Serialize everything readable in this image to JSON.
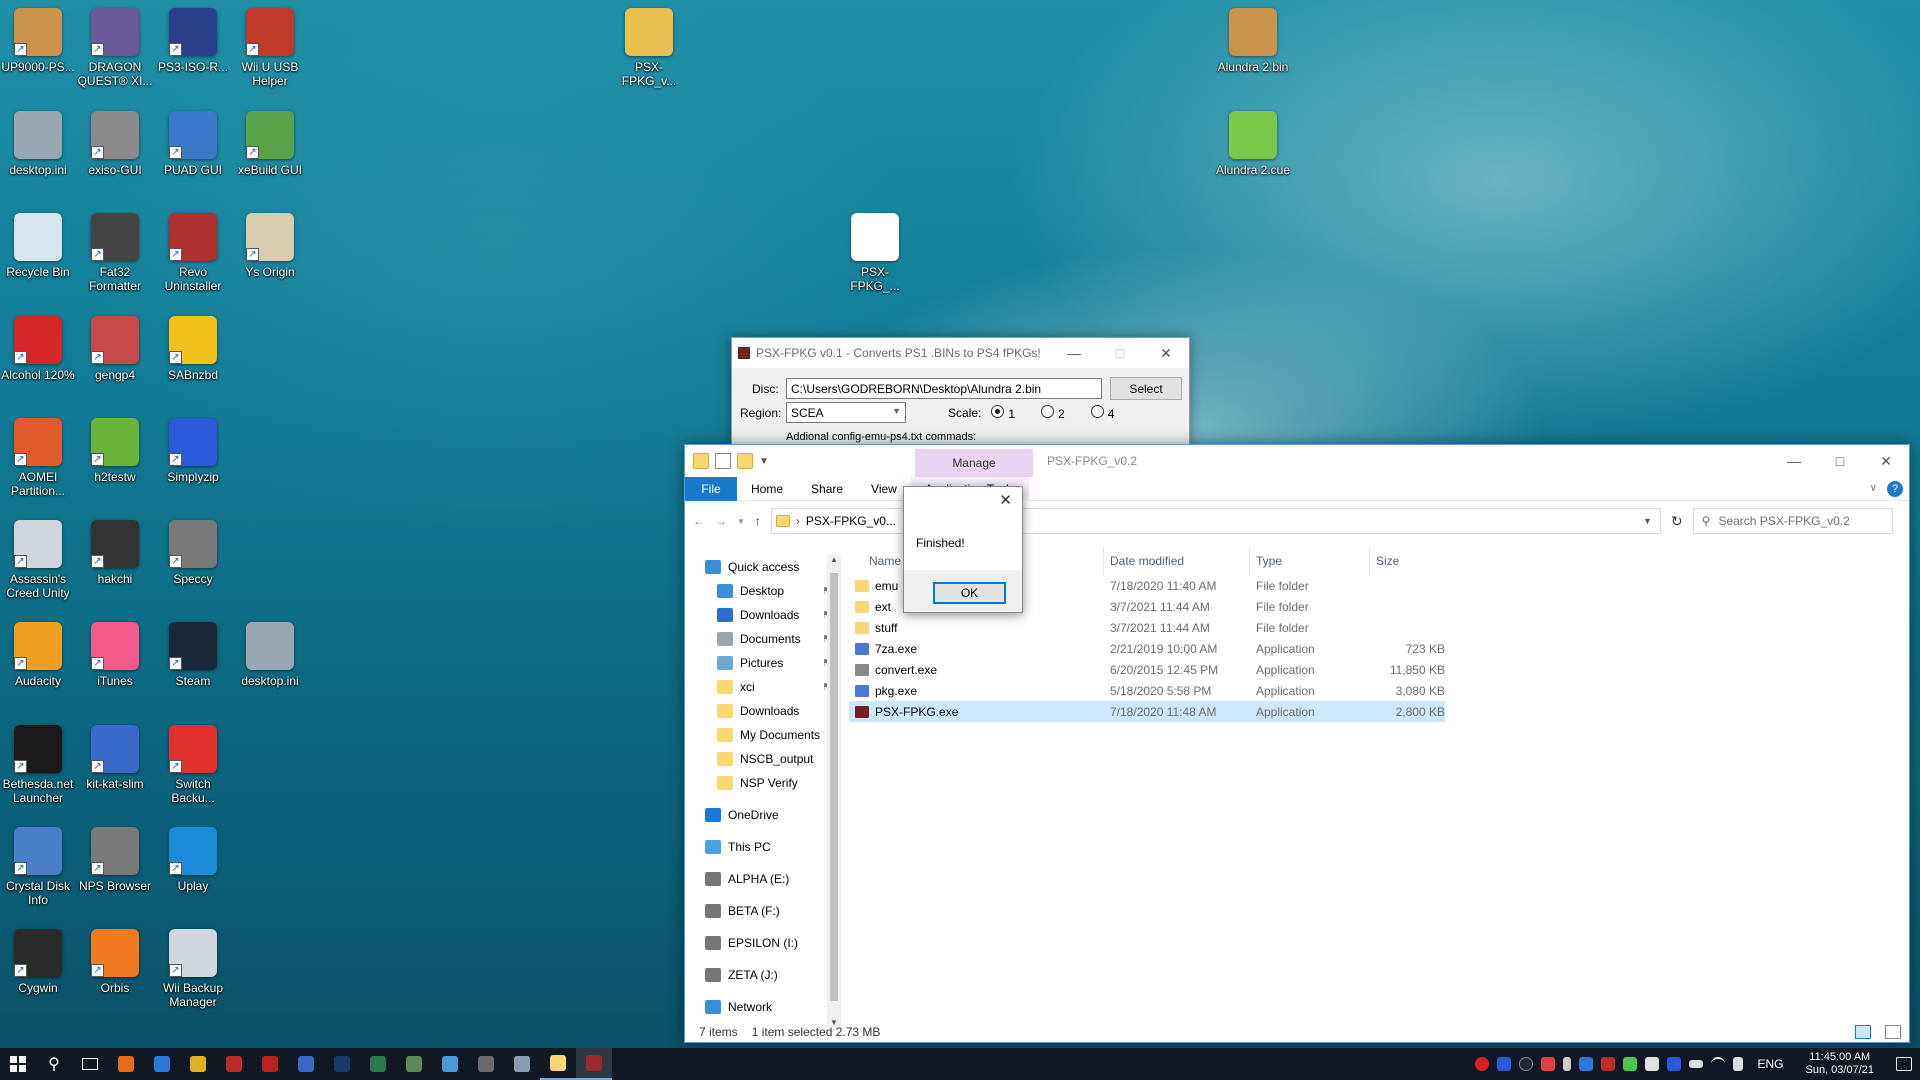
{
  "desktop_icons": [
    {
      "label": "UP9000-PS...",
      "color": "#c8934a"
    },
    {
      "label": "DRAGON QUEST® XI...",
      "color": "#6b5a9a"
    },
    {
      "label": "PS3-ISO-R...",
      "color": "#2a3f8a"
    },
    {
      "label": "Wii U USB Helper",
      "color": "#c0392b"
    },
    {
      "label": "desktop.ini",
      "color": "#9aa6b2"
    },
    {
      "label": "exiso-GUI",
      "color": "#8a8a8a"
    },
    {
      "label": "PUAD GUI",
      "color": "#3a78c9"
    },
    {
      "label": "xeBuild GUI",
      "color": "#5aa34a"
    },
    {
      "label": "Recycle Bin",
      "color": "#d8e4ee"
    },
    {
      "label": "Fat32 Formatter",
      "color": "#444444"
    },
    {
      "label": "Revo Uninstaller",
      "color": "#b03030"
    },
    {
      "label": "Ys Origin",
      "color": "#d8cdb0"
    },
    {
      "label": "Alcohol 120%",
      "color": "#d42626"
    },
    {
      "label": "gengp4",
      "color": "#c84a4a"
    },
    {
      "label": "SABnzbd",
      "color": "#f2c21b"
    },
    {
      "label": "AOMEI Partition...",
      "color": "#e05a2a"
    },
    {
      "label": "h2testw",
      "color": "#6ab43a"
    },
    {
      "label": "Simplyzip",
      "color": "#2a5ad9"
    },
    {
      "label": "Assassin's Creed Unity",
      "color": "#d0d6de"
    },
    {
      "label": "hakchi",
      "color": "#333333"
    },
    {
      "label": "Speccy",
      "color": "#7a7a7a"
    },
    {
      "label": "Audacity",
      "color": "#f0a020"
    },
    {
      "label": "iTunes",
      "color": "#f25a8a"
    },
    {
      "label": "Steam",
      "color": "#1b2838"
    },
    {
      "label": "desktop.ini",
      "color": "#9aa6b2"
    },
    {
      "label": "Bethesda.net Launcher",
      "color": "#1a1a1a"
    },
    {
      "label": "kit-kat-slim",
      "color": "#3a6ac9"
    },
    {
      "label": "Switch Backu...",
      "color": "#e03030"
    },
    {
      "label": "Crystal Disk Info",
      "color": "#4a80c9"
    },
    {
      "label": "NPS Browser",
      "color": "#7a7a7a"
    },
    {
      "label": "Uplay",
      "color": "#1a8ad9"
    },
    {
      "label": "Cygwin",
      "color": "#2a2a2a"
    },
    {
      "label": "Orbis",
      "color": "#f07a20"
    },
    {
      "label": "Wii Backup Manager",
      "color": "#d0d6de"
    },
    {
      "label": "PSX-FPKG_v...",
      "color": "#e8c050"
    },
    {
      "label": "PSX-FPKG_...",
      "color": "#ffffff"
    },
    {
      "label": "Alundra 2.bin",
      "color": "#c8934a"
    },
    {
      "label": "Alundra 2.cue",
      "color": "#7ac84a"
    }
  ],
  "psx_window": {
    "title": "PSX-FPKG v0.1 - Converts PS1 .BINs to PS4 fPKGs!",
    "disc_label": "Disc:",
    "disc_value": "C:\\Users\\GODREBORN\\Desktop\\Alundra 2.bin",
    "select_button": "Select",
    "region_label": "Region:",
    "region_value": "SCEA",
    "scale_label": "Scale:",
    "scale_options": [
      "1",
      "2",
      "4"
    ],
    "scale_selected": "1",
    "additional_label": "Addional config-emu-ps4.txt commads:"
  },
  "explorer": {
    "title": "PSX-FPKG_v0.2",
    "manage_label": "Manage",
    "tabs": [
      "File",
      "Home",
      "Share",
      "View",
      "Application Tools"
    ],
    "address": "PSX-FPKG_v0...",
    "search_placeholder": "Search PSX-FPKG_v0.2",
    "nav": {
      "quick_access": "Quick access",
      "items": [
        {
          "label": "Desktop",
          "pinned": true,
          "color": "#3a8fd9"
        },
        {
          "label": "Downloads",
          "pinned": true,
          "color": "#2a6fc9"
        },
        {
          "label": "Documents",
          "pinned": true,
          "color": "#9aa6b2"
        },
        {
          "label": "Pictures",
          "pinned": true,
          "color": "#6aaad9"
        },
        {
          "label": "xci",
          "pinned": true,
          "color": "#f8d775"
        },
        {
          "label": "Downloads",
          "pinned": false,
          "color": "#f8d775"
        },
        {
          "label": "My Documents",
          "pinned": false,
          "color": "#f8d775"
        },
        {
          "label": "NSCB_output",
          "pinned": false,
          "color": "#f8d775"
        },
        {
          "label": "NSP Verify",
          "pinned": false,
          "color": "#f8d775"
        }
      ],
      "onedrive": "OneDrive",
      "this_pc": "This PC",
      "drives": [
        "ALPHA (E:)",
        "BETA (F:)",
        "EPSILON (I:)",
        "ZETA (J:)"
      ],
      "network": "Network"
    },
    "columns": [
      "Name",
      "Date modified",
      "Type",
      "Size"
    ],
    "files": [
      {
        "name": "emu",
        "date": "7/18/2020 11:40 AM",
        "type": "File folder",
        "size": "",
        "icon": "folder"
      },
      {
        "name": "ext",
        "date": "3/7/2021 11:44 AM",
        "type": "File folder",
        "size": "",
        "icon": "folder"
      },
      {
        "name": "stuff",
        "date": "3/7/2021 11:44 AM",
        "type": "File folder",
        "size": "",
        "icon": "folder"
      },
      {
        "name": "7za.exe",
        "date": "2/21/2019 10:00 AM",
        "type": "Application",
        "size": "723 KB",
        "icon": "exe"
      },
      {
        "name": "convert.exe",
        "date": "6/20/2015 12:45 PM",
        "type": "Application",
        "size": "11,850 KB",
        "icon": "pen"
      },
      {
        "name": "pkg.exe",
        "date": "5/18/2020 5:58 PM",
        "type": "Application",
        "size": "3,080 KB",
        "icon": "exe"
      },
      {
        "name": "PSX-FPKG.exe",
        "date": "7/18/2020 11:48 AM",
        "type": "Application",
        "size": "2,800 KB",
        "icon": "psx"
      }
    ],
    "status": {
      "count": "7 items",
      "selected": "1 item selected  2.73 MB"
    }
  },
  "dialog": {
    "message": "Finished!",
    "ok": "OK"
  },
  "taskbar": {
    "apps": [
      {
        "name": "firefox-icon",
        "color": "#e86a1a"
      },
      {
        "name": "mail-icon",
        "color": "#2a78d9"
      },
      {
        "name": "chrome-icon",
        "color": "#e0b020"
      },
      {
        "name": "media-icon",
        "color": "#c02a2a"
      },
      {
        "name": "filezilla-icon",
        "color": "#c02020"
      },
      {
        "name": "window-icon",
        "color": "#3a6ac9"
      },
      {
        "name": "photoshop-icon",
        "color": "#1a3a6a"
      },
      {
        "name": "excel-icon",
        "color": "#2a7a4a"
      },
      {
        "name": "app-icon",
        "color": "#5a8a5a"
      },
      {
        "name": "monitor-icon",
        "color": "#4a9ad9"
      },
      {
        "name": "calculator-icon",
        "color": "#6a6a6a"
      },
      {
        "name": "network-icon",
        "color": "#8a9ab0"
      },
      {
        "name": "explorer-icon",
        "color": "#f8d775"
      },
      {
        "name": "psx-fpkg-icon",
        "color": "#a02a2a"
      }
    ],
    "language": "ENG",
    "time": "11:45:00 AM",
    "date": "Sun, 03/07/21"
  }
}
